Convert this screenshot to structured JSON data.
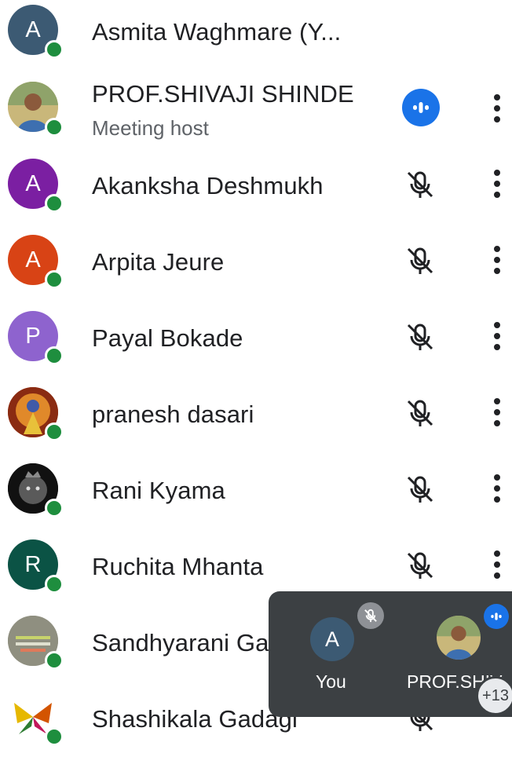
{
  "participants": [
    {
      "name": "Asmita Waghmare (Y...",
      "initial": "A",
      "color": "#3c5a73",
      "mic": "none"
    },
    {
      "name": "PROF.SHIVAJI SHINDE",
      "subtitle": "Meeting host",
      "initial": "",
      "color": "#6a8a5a",
      "mic": "speaking"
    },
    {
      "name": "Akanksha Deshmukh",
      "initial": "A",
      "color": "#7b1fa2",
      "mic": "muted"
    },
    {
      "name": "Arpita Jeure",
      "initial": "A",
      "color": "#d84315",
      "mic": "muted"
    },
    {
      "name": "Payal Bokade",
      "initial": "P",
      "color": "#8e63ce",
      "mic": "muted"
    },
    {
      "name": "pranesh dasari",
      "initial": "",
      "color": "#b3471f",
      "mic": "muted"
    },
    {
      "name": "Rani Kyama",
      "initial": "",
      "color": "#1b1b1b",
      "mic": "muted"
    },
    {
      "name": "Ruchita Mhanta",
      "initial": "R",
      "color": "#0b5345",
      "mic": "muted"
    },
    {
      "name": "Sandhyarani Ga",
      "initial": "",
      "color": "#9a9a8a",
      "mic": "muted"
    },
    {
      "name": "Shashikala Gadagi",
      "initial": "",
      "color": "#f1c40f",
      "mic": "muted"
    }
  ],
  "overlay": {
    "you_label": "You",
    "you_initial": "A",
    "other_label": "PROF.SHIV",
    "more_count": "+13"
  },
  "colors": {
    "online": "#1e8e3e",
    "accent": "#1a73e8",
    "overlay_bg": "#3c4043"
  }
}
